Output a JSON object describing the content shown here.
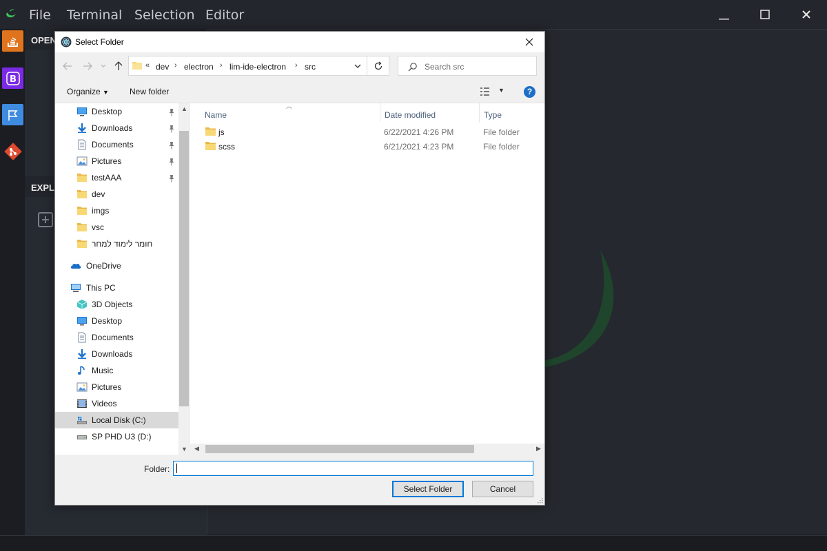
{
  "ide": {
    "menu": [
      "File",
      "Terminal",
      "Selection",
      "Editor"
    ],
    "sidebar_headers": [
      "OPEN",
      "EXPL"
    ]
  },
  "dialog": {
    "title": "Select Folder",
    "close_glyph": "✕",
    "address": {
      "overflow": "«",
      "crumbs": [
        "dev",
        "electron",
        "lim-ide-electron",
        "src"
      ]
    },
    "search_placeholder": "Search src",
    "commands": {
      "organize": "Organize",
      "new_folder": "New folder"
    },
    "help_label": "?",
    "nav_items": [
      {
        "label": "Desktop",
        "icon": "desktop-icon",
        "pinned": true
      },
      {
        "label": "Downloads",
        "icon": "downloads-icon",
        "pinned": true
      },
      {
        "label": "Documents",
        "icon": "documents-icon",
        "pinned": true
      },
      {
        "label": "Pictures",
        "icon": "pictures-icon",
        "pinned": true
      },
      {
        "label": "testAAA",
        "icon": "folder-icon",
        "pinned": true
      },
      {
        "label": "dev",
        "icon": "folder-icon"
      },
      {
        "label": "imgs",
        "icon": "folder-icon"
      },
      {
        "label": "vsc",
        "icon": "folder-icon"
      },
      {
        "label": "חומר לימוד למחר",
        "icon": "folder-icon"
      },
      {
        "label": "OneDrive",
        "icon": "onedrive-icon"
      },
      {
        "label": "This PC",
        "icon": "this-pc-icon"
      },
      {
        "label": "3D Objects",
        "icon": "3d-objects-icon"
      },
      {
        "label": "Desktop",
        "icon": "desktop-icon"
      },
      {
        "label": "Documents",
        "icon": "documents-icon"
      },
      {
        "label": "Downloads",
        "icon": "downloads-icon"
      },
      {
        "label": "Music",
        "icon": "music-icon"
      },
      {
        "label": "Pictures",
        "icon": "pictures-icon"
      },
      {
        "label": "Videos",
        "icon": "videos-icon"
      },
      {
        "label": "Local Disk (C:)",
        "icon": "drive-icon",
        "selected": true
      },
      {
        "label": "SP PHD U3 (D:)",
        "icon": "usb-drive-icon"
      }
    ],
    "columns": {
      "name": "Name",
      "date": "Date modified",
      "type": "Type"
    },
    "files": [
      {
        "name": "js",
        "date": "6/22/2021 4:26 PM",
        "type": "File folder"
      },
      {
        "name": "scss",
        "date": "6/21/2021 4:23 PM",
        "type": "File folder"
      }
    ],
    "folder_label": "Folder:",
    "folder_value": "",
    "buttons": {
      "select": "Select Folder",
      "cancel": "Cancel"
    }
  },
  "colors": {
    "accent": "#0078d7",
    "ide_bg": "#1e2127",
    "folder": "#f8d775"
  }
}
